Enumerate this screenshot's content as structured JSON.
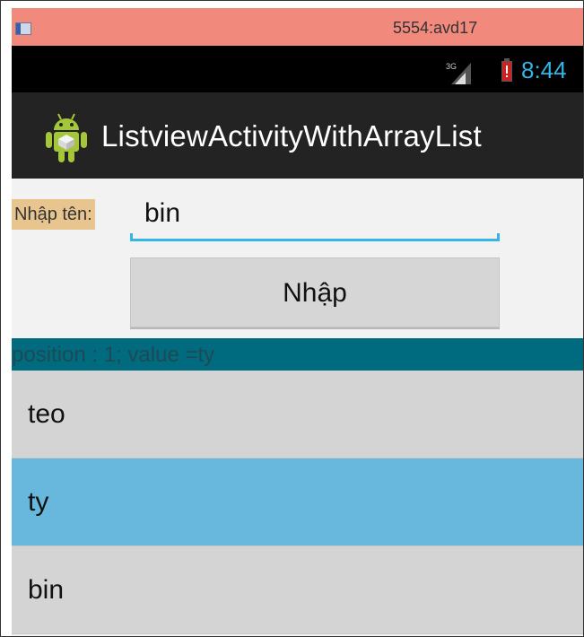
{
  "emulator": {
    "title": "5554:avd17"
  },
  "status_bar": {
    "network": "3G",
    "time": "8:44",
    "signal_icon": "signal-icon",
    "battery_icon": "battery-low-icon"
  },
  "action_bar": {
    "app_icon": "android-icon",
    "title": "ListviewActivityWithArrayList"
  },
  "form": {
    "label": "Nhập tên:",
    "input_value": "bin",
    "button_label": "Nhập"
  },
  "selection_text": "position : 1; value =ty",
  "list": {
    "items": [
      {
        "label": "teo",
        "selected": false
      },
      {
        "label": "ty",
        "selected": true
      },
      {
        "label": "bin",
        "selected": false
      }
    ]
  },
  "colors": {
    "emulator_bar": "#f18a7d",
    "accent": "#33b5e5",
    "selection_bar": "#006a7e",
    "selected_item": "#67b8dc",
    "label_bg": "#e8c48e"
  }
}
